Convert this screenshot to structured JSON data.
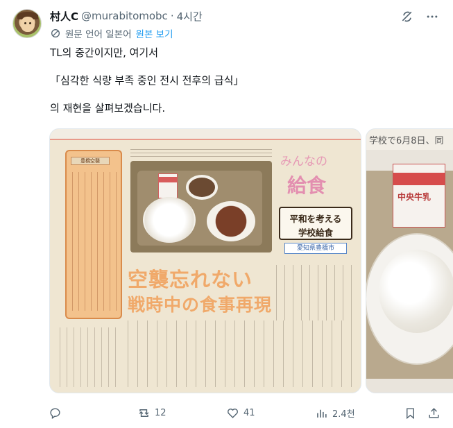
{
  "author": {
    "name": "村人C",
    "handle": "@murabitomobc",
    "separator": "·",
    "time": "4시간"
  },
  "top_icons": [
    "grok-icon",
    "more-icon"
  ],
  "translation": {
    "source_language_text": "원문 언어 일본어",
    "show_original_link": "원본 보기"
  },
  "tweet": {
    "line1": "TL의 중간이지만, 여기서",
    "line2": "「심각한 식량 부족 중인 전시 전후의 급식」",
    "line3": "의 재현을 살펴보겠습니다."
  },
  "media": {
    "photo1": {
      "side_box_title": "豊橋空襲",
      "logo_small": "みんなの",
      "logo_big": "給食",
      "subbox_line1": "平和を考える",
      "subbox_line2": "学校給食",
      "city": "愛知県豊橋市",
      "headline_line1": "空襲忘れない",
      "headline_line2": "戦時中の食事再現"
    },
    "photo2": {
      "top_text": "学校で6月8日、同",
      "milk_label": "中央牛乳"
    }
  },
  "actions": {
    "reply_count": "",
    "retweet_count": "12",
    "like_count": "41",
    "view_count": "2.4천"
  }
}
